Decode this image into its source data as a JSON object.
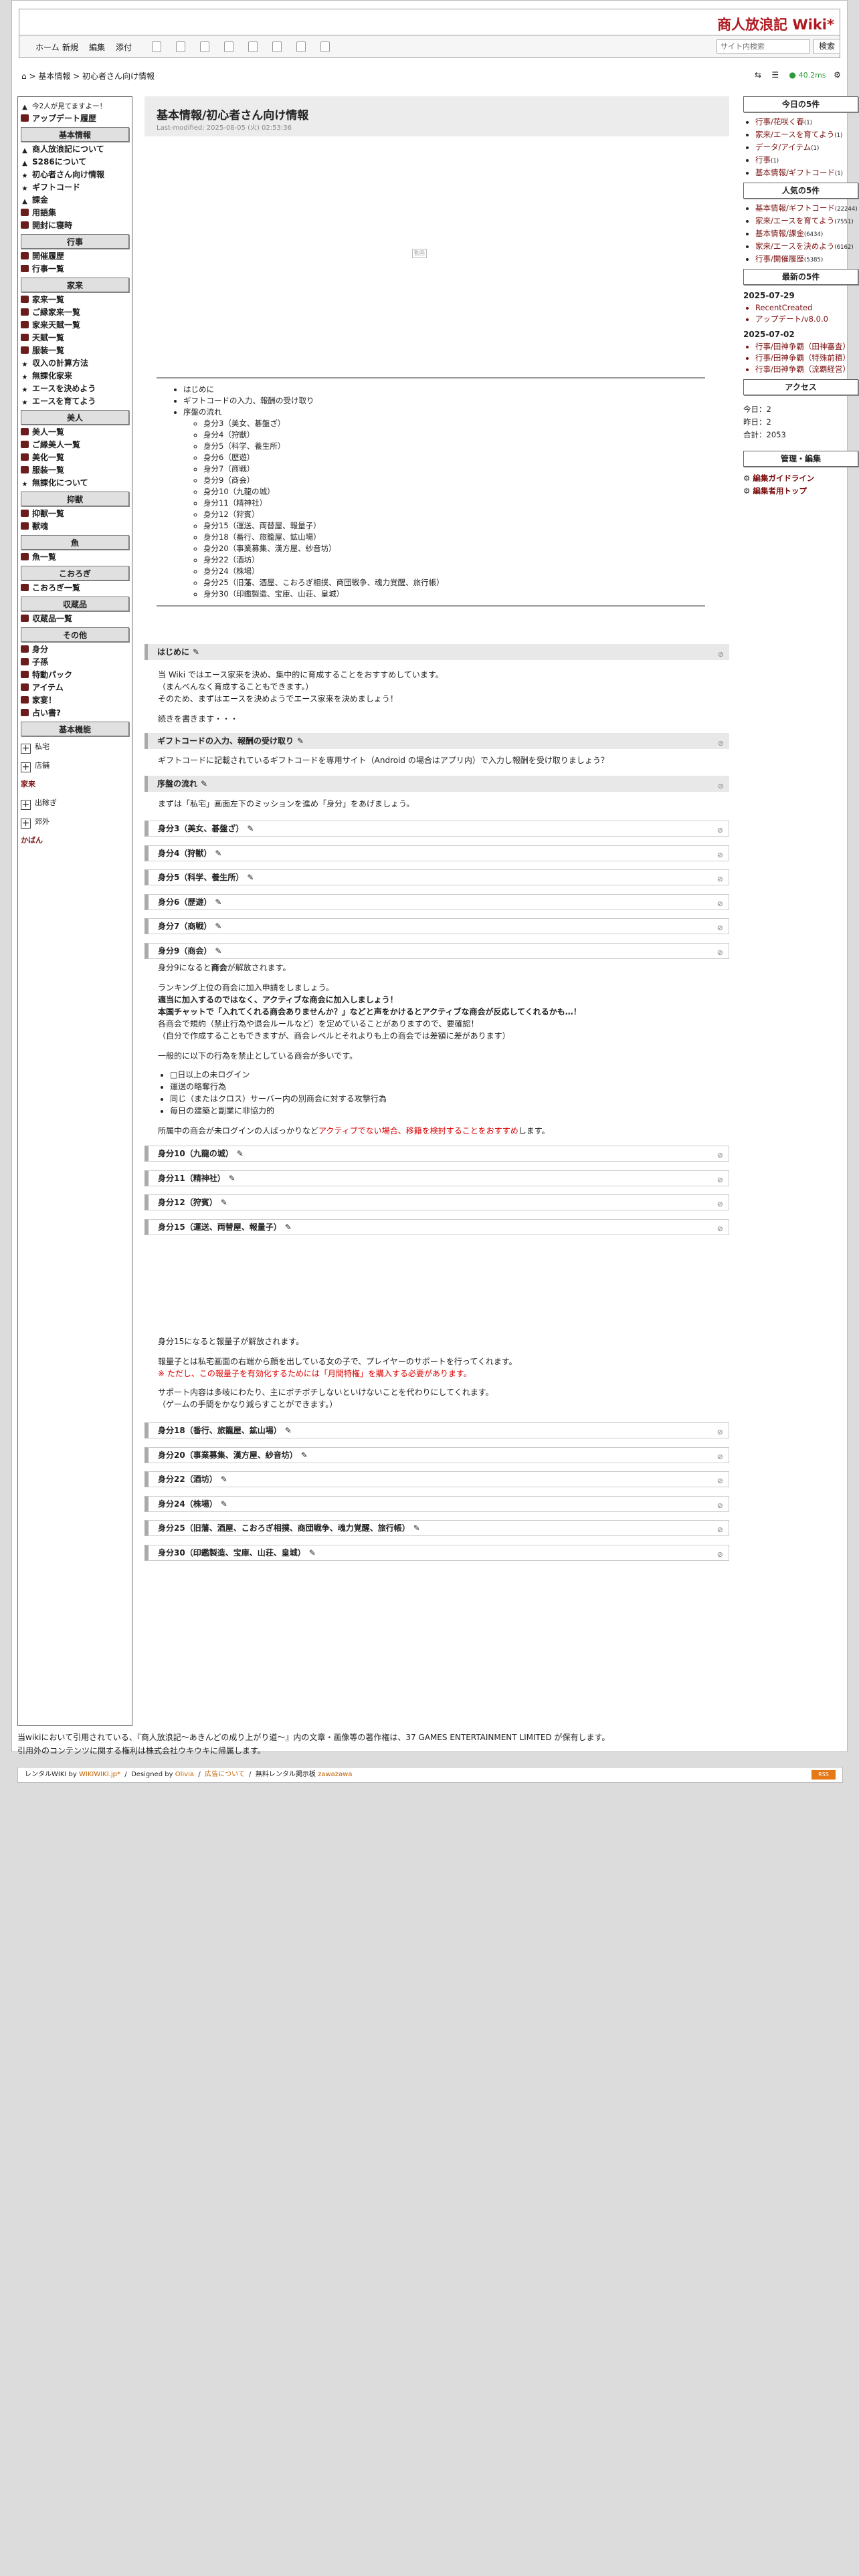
{
  "site": {
    "title": "商人放浪記 Wiki*"
  },
  "toolbar": {
    "home": "ホーム",
    "new": "新規",
    "edit": "編集",
    "attach": "添付",
    "search_placeholder": "サイト内検索",
    "search_button": "検索"
  },
  "breadcrumb": {
    "items": [
      "基本情報",
      "初心者さん向け情報"
    ],
    "sep": ">"
  },
  "header_stats": {
    "time": "40.2ms"
  },
  "leftnav": {
    "top": [
      {
        "icon": "tri",
        "label": "今2人が見てますよー！",
        "small": true
      },
      {
        "icon": "box",
        "label": "アップデート履歴",
        "bold": true
      }
    ],
    "sections": [
      {
        "title": "基本情報",
        "items": [
          {
            "icon": "tri",
            "label": "商人放浪記について"
          },
          {
            "icon": "tri",
            "label": "S286について"
          },
          {
            "icon": "star",
            "label": "初心者さん向け情報"
          },
          {
            "icon": "star",
            "label": "ギフトコード"
          },
          {
            "icon": "tri",
            "label": "課金"
          },
          {
            "icon": "box",
            "label": "用語集"
          },
          {
            "icon": "box",
            "label": "開封に寝時"
          }
        ]
      },
      {
        "title": "行事",
        "items": [
          {
            "icon": "box",
            "label": "開催履歴"
          },
          {
            "icon": "box",
            "label": "行事一覧"
          }
        ]
      },
      {
        "title": "家来",
        "items": [
          {
            "icon": "box",
            "label": "家来一覧"
          },
          {
            "icon": "box",
            "label": "ご縁家来一覧"
          },
          {
            "icon": "box",
            "label": "家来天賦一覧"
          },
          {
            "icon": "box",
            "label": "天賦一覧"
          },
          {
            "icon": "box",
            "label": "服装一覧"
          },
          {
            "icon": "star",
            "label": "収入の計算方法"
          },
          {
            "icon": "star",
            "label": "無課化家来"
          },
          {
            "icon": "star",
            "label": "エースを決めよう"
          },
          {
            "icon": "star",
            "label": "エースを育てよう"
          }
        ]
      },
      {
        "title": "美人",
        "items": [
          {
            "icon": "box",
            "label": "美人一覧"
          },
          {
            "icon": "box",
            "label": "ご縁美人一覧"
          },
          {
            "icon": "box",
            "label": "美化一覧"
          },
          {
            "icon": "box",
            "label": "服装一覧"
          },
          {
            "icon": "star",
            "label": "無課化について"
          }
        ]
      },
      {
        "title": "抑獣",
        "items": [
          {
            "icon": "box",
            "label": "抑獣一覧"
          },
          {
            "icon": "box",
            "label": "獣魂"
          }
        ]
      },
      {
        "title": "魚",
        "items": [
          {
            "icon": "box",
            "label": "魚一覧"
          }
        ]
      },
      {
        "title": "こおろぎ",
        "items": [
          {
            "icon": "box",
            "label": "こおろぎ一覧"
          }
        ]
      },
      {
        "title": "収蔵品",
        "items": [
          {
            "icon": "box",
            "label": "収蔵品一覧"
          }
        ]
      },
      {
        "title": "その他",
        "items": [
          {
            "icon": "box",
            "label": "身分"
          },
          {
            "icon": "box",
            "label": "子孫"
          },
          {
            "icon": "box",
            "label": "特動パック"
          },
          {
            "icon": "box",
            "label": "アイテム"
          },
          {
            "icon": "box",
            "label": "家宴！"
          },
          {
            "icon": "box",
            "label": "占い書?"
          }
        ]
      }
    ],
    "basic_title": "基本機能",
    "expand": [
      {
        "label": "私宅",
        "plus": true
      },
      {
        "label": "店舗",
        "plus": true
      },
      {
        "label": "家来",
        "plus": false
      },
      {
        "label": "出稼ぎ",
        "plus": true
      },
      {
        "label": "郊外",
        "plus": true
      },
      {
        "label": "かばん",
        "plus": false
      }
    ]
  },
  "page": {
    "title": "基本情報/初心者さん向け情報",
    "modified": "Last-modified: 2025-08-05 (火) 02:53:36",
    "video_label": "動画",
    "toc": [
      {
        "label": "はじめに",
        "children": []
      },
      {
        "label": "ギフトコードの入力、報酬の受け取り",
        "children": []
      },
      {
        "label": "序盤の流れ",
        "children": [
          "身分3（美女、碁盤ざ）",
          "身分4（狩獣）",
          "身分5（科学、養生所）",
          "身分6（歴遊）",
          "身分7（商戦）",
          "身分9（商会）",
          "身分10（九龍の城）",
          "身分11（精神社）",
          "身分12（狩賓）",
          "身分15（運送、両替屋、報量子）",
          "身分18（番行、旅籠屋、鉱山場）",
          "身分20（事業募集、漢方屋、紗音坊）",
          "身分22（酒坊）",
          "身分24（株場）",
          "身分25（旧藩、酒屋、こおろぎ相撲、商団戦争、魂力覚醒、旅行帳）",
          "身分30（印鑑製造、宝庫、山荘、皇城）"
        ]
      }
    ],
    "hajime": {
      "heading": "はじめに",
      "lines": [
        "当 Wiki ではエース家来を決め、集中的に育成することをおすすめしています。",
        "（まんべんなく育成することもできます。）",
        "そのため、まずはエースを決めようでエース家来を決めましょう！",
        "",
        "続きを書きます・・・"
      ]
    },
    "gift": {
      "heading": "ギフトコードの入力、報酬の受け取り",
      "text": "ギフトコードに記載されているギフトコードを専用サイト（Android の場合はアプリ内）で入力し報酬を受け取りましょう？"
    },
    "flow": {
      "heading": "序盤の流れ",
      "text": "まずは「私宅」画面左下のミッションを進め「身分」をあげましょう。"
    },
    "sub_a": [
      "身分3（美女、碁盤ざ）",
      "身分4（狩獣）",
      "身分5（科学、養生所）",
      "身分6（歴遊）",
      "身分7（商戦）",
      "身分9（商会）"
    ],
    "shokai": {
      "p1": "身分9になると商会が解放されます。",
      "p2": "ランキング上位の商会に加入申請をしましょう。",
      "p3": "適当に加入するのではなく、アクティブな商会に加入しましょう！",
      "p4": "本国チャットで「入れてくれる商会ありませんか？」などと声をかけるとアクティブな商会が反応してくれるかも…！",
      "p5": "各商会で規約（禁止行為や退会ルールなど）を定めていることがありますので、要確認！",
      "p6": "（自分で作成することもできますが、商会レベルとそれよりも上の商会では差額に差があります）",
      "p7": "一般的に以下の行為を禁止としている商会が多いです。",
      "rules": [
        "□日以上の未ログイン",
        "運送の略奪行為",
        "同じ（またはクロス）サーバー内の別商会に対する攻撃行為",
        "毎日の建築と副業に非協力的"
      ],
      "p8a": "所属中の商会が未ログインの人ばっかりなど",
      "p8b": "アクティブでない場合、移籍を検討することをおすすめ",
      "p8c": "します。"
    },
    "sub_b": [
      "身分10（九龍の城）",
      "身分11（精神社）",
      "身分12（狩賓）",
      "身分15（運送、両替屋、報量子）"
    ],
    "s15": {
      "p1": "身分15になると報量子が解放されます。",
      "p2": "報量子とは私宅画面の右端から顔を出している女の子で、プレイヤーのサポートを行ってくれます。",
      "p3": "※ ただし、この報量子を有効化するためには「月間特権」を購入する必要があります。",
      "p4": "サポート内容は多岐にわたり、主にボチボチしないといけないことを代わりにしてくれます。",
      "p5": "（ゲームの手間をかなり減らすことができます。）"
    },
    "sub_c": [
      "身分18（番行、旅籠屋、鉱山場）",
      "身分20（事業募集、漢方屋、紗音坊）",
      "身分22（酒坊）",
      "身分24（株場）",
      "身分25（旧藩、酒屋、こおろぎ相撲、商団戦争、魂力覚醒、旅行帳）",
      "身分30（印鑑製造、宝庫、山荘、皇城）"
    ]
  },
  "rightnav": {
    "today_title": "今日の5件",
    "today": [
      {
        "label": "行事/花咲く春",
        "cnt": "(1)"
      },
      {
        "label": "家来/エースを育てよう",
        "cnt": "(1)"
      },
      {
        "label": "データ/アイテム",
        "cnt": "(1)"
      },
      {
        "label": "行事",
        "cnt": "(1)"
      },
      {
        "label": "基本情報/ギフトコード",
        "cnt": "(1)"
      }
    ],
    "popular_title": "人気の5件",
    "popular": [
      {
        "label": "基本情報/ギフトコード",
        "cnt": "(22244)"
      },
      {
        "label": "家来/エースを育てよう",
        "cnt": "(7551)"
      },
      {
        "label": "基本情報/課金",
        "cnt": "(6434)"
      },
      {
        "label": "家来/エースを決めよう",
        "cnt": "(6162)"
      },
      {
        "label": "行事/開催履歴",
        "cnt": "(5385)"
      }
    ],
    "latest_title": "最新の5件",
    "latest_dates": [
      {
        "date": "2025-07-29",
        "items": [
          "RecentCreated",
          "アップデート/v8.0.0"
        ]
      },
      {
        "date": "2025-07-02",
        "items": [
          "行事/田神争覇（田神審査）",
          "行事/田神争覇（特殊前積）",
          "行事/田神争覇（流覇経営）"
        ]
      }
    ],
    "access_title": "アクセス",
    "access": {
      "today": "今日：2",
      "yesterday": "昨日：2",
      "total": "合計：2053"
    },
    "manage_title": "管理・編集",
    "manage": [
      "編集ガイドライン",
      "編集者用トップ"
    ]
  },
  "footer": {
    "line1": "当wikiにおいて引用されている、『商人放浪記～あきんどの成り上がり道～』内の文章・画像等の著作権は、37 GAMES ENTERTAINMENT LIMITED が保有します。",
    "line2": "引用外のコンテンツに関する権利は株式会社ウキウキに帰属します。",
    "rental": "レンタルWIKI by",
    "wikiwiki": "WIKIWIKI.jp*",
    "designed": "Designed by",
    "olivia": "Olivia",
    "ad": "広告について",
    "free": "無料レンタル掲示板",
    "zawazawa": "zawazawa",
    "rss": "RSS"
  }
}
